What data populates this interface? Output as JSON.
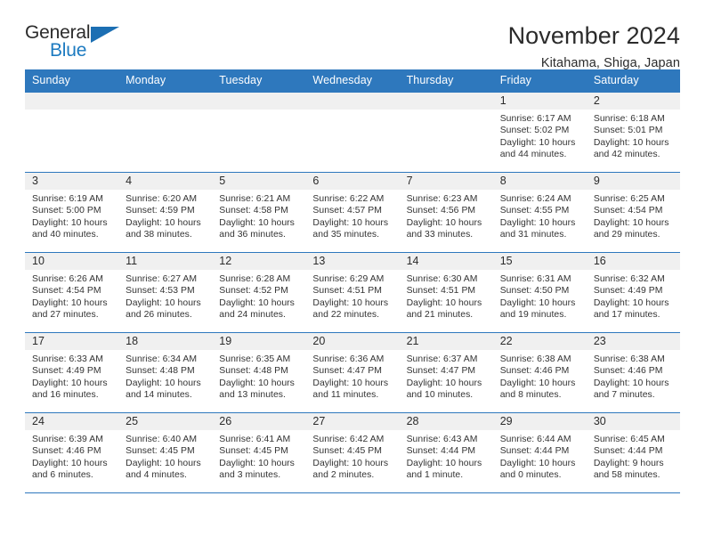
{
  "brand": {
    "name_part1": "General",
    "name_part2": "Blue",
    "triangle_color": "#1c6fb3",
    "blue_text_color": "#1c7ac0"
  },
  "header": {
    "month_title": "November 2024",
    "location": "Kitahama, Shiga, Japan"
  },
  "theme": {
    "header_blue": "#2e78bd",
    "daynum_gray": "#f0f0f0",
    "text_dark": "#2b2b2b"
  },
  "calendar": {
    "weekday_headers": [
      "Sunday",
      "Monday",
      "Tuesday",
      "Wednesday",
      "Thursday",
      "Friday",
      "Saturday"
    ],
    "labels": {
      "sunrise": "Sunrise:",
      "sunset": "Sunset:",
      "daylight": "Daylight:"
    },
    "weeks": [
      [
        {
          "day": "",
          "empty": true
        },
        {
          "day": "",
          "empty": true
        },
        {
          "day": "",
          "empty": true
        },
        {
          "day": "",
          "empty": true
        },
        {
          "day": "",
          "empty": true
        },
        {
          "day": "1",
          "sunrise": "Sunrise: 6:17 AM",
          "sunset": "Sunset: 5:02 PM",
          "daylight_line1": "Daylight: 10 hours",
          "daylight_line2": "and 44 minutes."
        },
        {
          "day": "2",
          "sunrise": "Sunrise: 6:18 AM",
          "sunset": "Sunset: 5:01 PM",
          "daylight_line1": "Daylight: 10 hours",
          "daylight_line2": "and 42 minutes."
        }
      ],
      [
        {
          "day": "3",
          "sunrise": "Sunrise: 6:19 AM",
          "sunset": "Sunset: 5:00 PM",
          "daylight_line1": "Daylight: 10 hours",
          "daylight_line2": "and 40 minutes."
        },
        {
          "day": "4",
          "sunrise": "Sunrise: 6:20 AM",
          "sunset": "Sunset: 4:59 PM",
          "daylight_line1": "Daylight: 10 hours",
          "daylight_line2": "and 38 minutes."
        },
        {
          "day": "5",
          "sunrise": "Sunrise: 6:21 AM",
          "sunset": "Sunset: 4:58 PM",
          "daylight_line1": "Daylight: 10 hours",
          "daylight_line2": "and 36 minutes."
        },
        {
          "day": "6",
          "sunrise": "Sunrise: 6:22 AM",
          "sunset": "Sunset: 4:57 PM",
          "daylight_line1": "Daylight: 10 hours",
          "daylight_line2": "and 35 minutes."
        },
        {
          "day": "7",
          "sunrise": "Sunrise: 6:23 AM",
          "sunset": "Sunset: 4:56 PM",
          "daylight_line1": "Daylight: 10 hours",
          "daylight_line2": "and 33 minutes."
        },
        {
          "day": "8",
          "sunrise": "Sunrise: 6:24 AM",
          "sunset": "Sunset: 4:55 PM",
          "daylight_line1": "Daylight: 10 hours",
          "daylight_line2": "and 31 minutes."
        },
        {
          "day": "9",
          "sunrise": "Sunrise: 6:25 AM",
          "sunset": "Sunset: 4:54 PM",
          "daylight_line1": "Daylight: 10 hours",
          "daylight_line2": "and 29 minutes."
        }
      ],
      [
        {
          "day": "10",
          "sunrise": "Sunrise: 6:26 AM",
          "sunset": "Sunset: 4:54 PM",
          "daylight_line1": "Daylight: 10 hours",
          "daylight_line2": "and 27 minutes."
        },
        {
          "day": "11",
          "sunrise": "Sunrise: 6:27 AM",
          "sunset": "Sunset: 4:53 PM",
          "daylight_line1": "Daylight: 10 hours",
          "daylight_line2": "and 26 minutes."
        },
        {
          "day": "12",
          "sunrise": "Sunrise: 6:28 AM",
          "sunset": "Sunset: 4:52 PM",
          "daylight_line1": "Daylight: 10 hours",
          "daylight_line2": "and 24 minutes."
        },
        {
          "day": "13",
          "sunrise": "Sunrise: 6:29 AM",
          "sunset": "Sunset: 4:51 PM",
          "daylight_line1": "Daylight: 10 hours",
          "daylight_line2": "and 22 minutes."
        },
        {
          "day": "14",
          "sunrise": "Sunrise: 6:30 AM",
          "sunset": "Sunset: 4:51 PM",
          "daylight_line1": "Daylight: 10 hours",
          "daylight_line2": "and 21 minutes."
        },
        {
          "day": "15",
          "sunrise": "Sunrise: 6:31 AM",
          "sunset": "Sunset: 4:50 PM",
          "daylight_line1": "Daylight: 10 hours",
          "daylight_line2": "and 19 minutes."
        },
        {
          "day": "16",
          "sunrise": "Sunrise: 6:32 AM",
          "sunset": "Sunset: 4:49 PM",
          "daylight_line1": "Daylight: 10 hours",
          "daylight_line2": "and 17 minutes."
        }
      ],
      [
        {
          "day": "17",
          "sunrise": "Sunrise: 6:33 AM",
          "sunset": "Sunset: 4:49 PM",
          "daylight_line1": "Daylight: 10 hours",
          "daylight_line2": "and 16 minutes."
        },
        {
          "day": "18",
          "sunrise": "Sunrise: 6:34 AM",
          "sunset": "Sunset: 4:48 PM",
          "daylight_line1": "Daylight: 10 hours",
          "daylight_line2": "and 14 minutes."
        },
        {
          "day": "19",
          "sunrise": "Sunrise: 6:35 AM",
          "sunset": "Sunset: 4:48 PM",
          "daylight_line1": "Daylight: 10 hours",
          "daylight_line2": "and 13 minutes."
        },
        {
          "day": "20",
          "sunrise": "Sunrise: 6:36 AM",
          "sunset": "Sunset: 4:47 PM",
          "daylight_line1": "Daylight: 10 hours",
          "daylight_line2": "and 11 minutes."
        },
        {
          "day": "21",
          "sunrise": "Sunrise: 6:37 AM",
          "sunset": "Sunset: 4:47 PM",
          "daylight_line1": "Daylight: 10 hours",
          "daylight_line2": "and 10 minutes."
        },
        {
          "day": "22",
          "sunrise": "Sunrise: 6:38 AM",
          "sunset": "Sunset: 4:46 PM",
          "daylight_line1": "Daylight: 10 hours",
          "daylight_line2": "and 8 minutes."
        },
        {
          "day": "23",
          "sunrise": "Sunrise: 6:38 AM",
          "sunset": "Sunset: 4:46 PM",
          "daylight_line1": "Daylight: 10 hours",
          "daylight_line2": "and 7 minutes."
        }
      ],
      [
        {
          "day": "24",
          "sunrise": "Sunrise: 6:39 AM",
          "sunset": "Sunset: 4:46 PM",
          "daylight_line1": "Daylight: 10 hours",
          "daylight_line2": "and 6 minutes."
        },
        {
          "day": "25",
          "sunrise": "Sunrise: 6:40 AM",
          "sunset": "Sunset: 4:45 PM",
          "daylight_line1": "Daylight: 10 hours",
          "daylight_line2": "and 4 minutes."
        },
        {
          "day": "26",
          "sunrise": "Sunrise: 6:41 AM",
          "sunset": "Sunset: 4:45 PM",
          "daylight_line1": "Daylight: 10 hours",
          "daylight_line2": "and 3 minutes."
        },
        {
          "day": "27",
          "sunrise": "Sunrise: 6:42 AM",
          "sunset": "Sunset: 4:45 PM",
          "daylight_line1": "Daylight: 10 hours",
          "daylight_line2": "and 2 minutes."
        },
        {
          "day": "28",
          "sunrise": "Sunrise: 6:43 AM",
          "sunset": "Sunset: 4:44 PM",
          "daylight_line1": "Daylight: 10 hours",
          "daylight_line2": "and 1 minute."
        },
        {
          "day": "29",
          "sunrise": "Sunrise: 6:44 AM",
          "sunset": "Sunset: 4:44 PM",
          "daylight_line1": "Daylight: 10 hours",
          "daylight_line2": "and 0 minutes."
        },
        {
          "day": "30",
          "sunrise": "Sunrise: 6:45 AM",
          "sunset": "Sunset: 4:44 PM",
          "daylight_line1": "Daylight: 9 hours",
          "daylight_line2": "and 58 minutes."
        }
      ]
    ]
  }
}
